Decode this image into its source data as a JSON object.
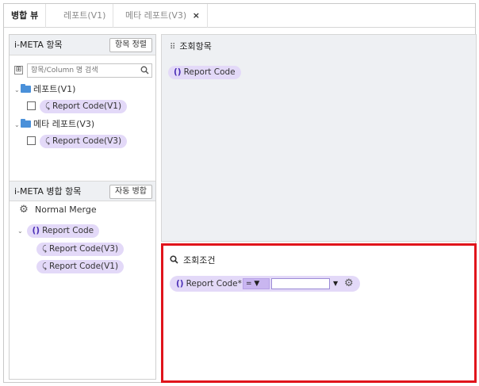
{
  "tabs": [
    {
      "label": "병합 뷰",
      "active": true
    },
    {
      "label": "레포트(V1)",
      "active": false
    },
    {
      "label": "메타 레포트(V3)",
      "active": false,
      "closable": true
    }
  ],
  "tab_close_glyph": "×",
  "meta_panel": {
    "title": "i-META 항목",
    "sort_button": "항목 정렬",
    "search_placeholder": "항목/Column 명 검색",
    "expand_glyph": "⊞",
    "tree": {
      "folder1": {
        "label": "레포트(V1)",
        "item": "Report Code(V1)"
      },
      "folder2": {
        "label": "메타 레포트(V3)",
        "item": "Report Code(V3)"
      }
    }
  },
  "merge_panel": {
    "title": "i-META 병합 항목",
    "auto_button": "자동 병합",
    "merge_type": "Normal Merge",
    "root": "Report Code",
    "children": [
      "Report Code(V3)",
      "Report Code(V1)"
    ]
  },
  "query_items": {
    "title": "조회항목",
    "items": [
      "Report Code"
    ]
  },
  "conditions": {
    "title": "조회조건",
    "label": "Report Code*",
    "operator": "=",
    "value": ""
  },
  "icons": {
    "grid": "grid-icon",
    "search": "search-icon",
    "gear": "gear-icon",
    "paren": "()",
    "link": "link-icon"
  },
  "colors": {
    "pill": "#e3d9f8",
    "accent": "#4b2fb6",
    "highlight_border": "#e0141b",
    "folder": "#4a90d9"
  }
}
